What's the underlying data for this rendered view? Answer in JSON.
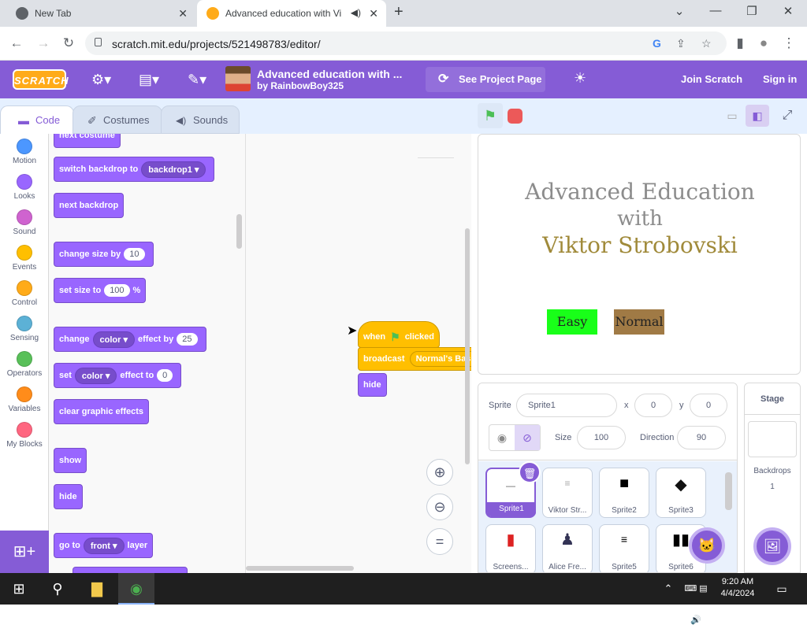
{
  "browser": {
    "tabs": [
      {
        "label": "New Tab",
        "close": "✕"
      },
      {
        "label": "Advanced education with Vi",
        "close": "✕"
      }
    ],
    "new_tab": "+",
    "window": {
      "minimize": "—",
      "restore": "❐",
      "close": "✕",
      "chevron": "⌄"
    },
    "nav": {
      "back": "←",
      "forward": "→",
      "reload": "↻"
    },
    "url": "scratch.mit.edu/projects/521498783/editor/",
    "omni_icons": {
      "google": "G",
      "share": "⇪",
      "star": "☆",
      "sidepanel": "▮",
      "profile": "●",
      "menu": "⋮"
    }
  },
  "menubar": {
    "logo": "SCRATCH",
    "settings_icon": "⚙▾",
    "file_icon": "▤▾",
    "edit_icon": "✎▾",
    "project_title": "Advanced education with ...",
    "project_by": "by RainbowBoy325",
    "see_project": "See Project Page",
    "see_project_icon": "⟳",
    "theme_icon": "☀",
    "join": "Join Scratch",
    "signin": "Sign in"
  },
  "editor_tabs": {
    "code": "Code",
    "code_icon": "▬",
    "costumes": "Costumes",
    "costumes_icon": "✐",
    "sounds": "Sounds",
    "sounds_icon": "◀)"
  },
  "categories": [
    {
      "label": "Motion",
      "color": "#4c97ff"
    },
    {
      "label": "Looks",
      "color": "#9966ff"
    },
    {
      "label": "Sound",
      "color": "#cf63cf"
    },
    {
      "label": "Events",
      "color": "#ffbf00"
    },
    {
      "label": "Control",
      "color": "#ffab19"
    },
    {
      "label": "Sensing",
      "color": "#5cb1d6"
    },
    {
      "label": "Operators",
      "color": "#59c059"
    },
    {
      "label": "Variables",
      "color": "#ff8c1a"
    },
    {
      "label": "My Blocks",
      "color": "#ff6680"
    }
  ],
  "extension_icon": "⊞+",
  "palette": {
    "next_costume": "next costume",
    "switch_backdrop": "switch backdrop to",
    "switch_backdrop_value": "backdrop1 ▾",
    "next_backdrop": "next backdrop",
    "change_size": "change size by",
    "change_size_value": "10",
    "set_size": "set size to",
    "set_size_value": "100",
    "set_size_unit": "%",
    "change_effect": "change",
    "change_effect_menu": "color ▾",
    "change_effect_by": "effect by",
    "change_effect_value": "25",
    "set_effect": "set",
    "set_effect_menu": "color ▾",
    "set_effect_to": "effect to",
    "set_effect_value": "0",
    "clear_effects": "clear graphic effects",
    "show": "show",
    "hide": "hide",
    "go_to": "go to",
    "go_to_menu": "front ▾",
    "go_to_layer": "layer"
  },
  "script": {
    "when": "when",
    "flag_icon": "⚑",
    "clicked": "clicked",
    "broadcast": "broadcast",
    "broadcast_value": "Normal's Basic",
    "hide": "hide"
  },
  "zoom": {
    "in": "⊕",
    "out": "⊖",
    "reset": "="
  },
  "stage_controls": {
    "flag": "⚑",
    "small_stage_icon": "▭",
    "normal_stage_icon": "◧",
    "fullscreen_icon": "⤢"
  },
  "stage": {
    "line1": "Advanced Education",
    "line2": "with",
    "line3": "Viktor Strobovski",
    "easy": "Easy",
    "normal": "Normal",
    "easy_color": "#19ff19",
    "normal_color": "#a07a45"
  },
  "sprite_info": {
    "sprite_label": "Sprite",
    "sprite_name": "Sprite1",
    "x_label": "x",
    "x_value": "0",
    "y_label": "y",
    "y_value": "0",
    "show_icon": "◉",
    "hide_icon": "⊘",
    "size_label": "Size",
    "size_value": "100",
    "direction_label": "Direction",
    "direction_value": "90"
  },
  "sprites": [
    {
      "name": "Sprite1",
      "glyph": "—"
    },
    {
      "name": "Viktor Str...",
      "glyph": "≡"
    },
    {
      "name": "Sprite2",
      "glyph": "■"
    },
    {
      "name": "Sprite3",
      "glyph": "◆"
    },
    {
      "name": "Screens...",
      "glyph": "▮"
    },
    {
      "name": "Alice Fre...",
      "glyph": "♟"
    },
    {
      "name": "Sprite5",
      "glyph": "≡"
    },
    {
      "name": "Sprite6",
      "glyph": "▮▮"
    }
  ],
  "delete_icon": "🗑",
  "add_sprite_icon": "🐱",
  "stage_pane": {
    "title": "Stage",
    "backdrops_label": "Backdrops",
    "backdrops_count": "1",
    "add_backdrop_icon": "🖼"
  },
  "taskbar": {
    "start_icon": "⊞",
    "search_icon": "⚲",
    "explorer_icon": "▇",
    "chrome_icon": "◉",
    "tray_up": "⌃",
    "tray_icons": "⌨ ▤ 🔊",
    "time": "9:20 AM",
    "date": "4/4/2024",
    "notify_icon": "▭"
  }
}
